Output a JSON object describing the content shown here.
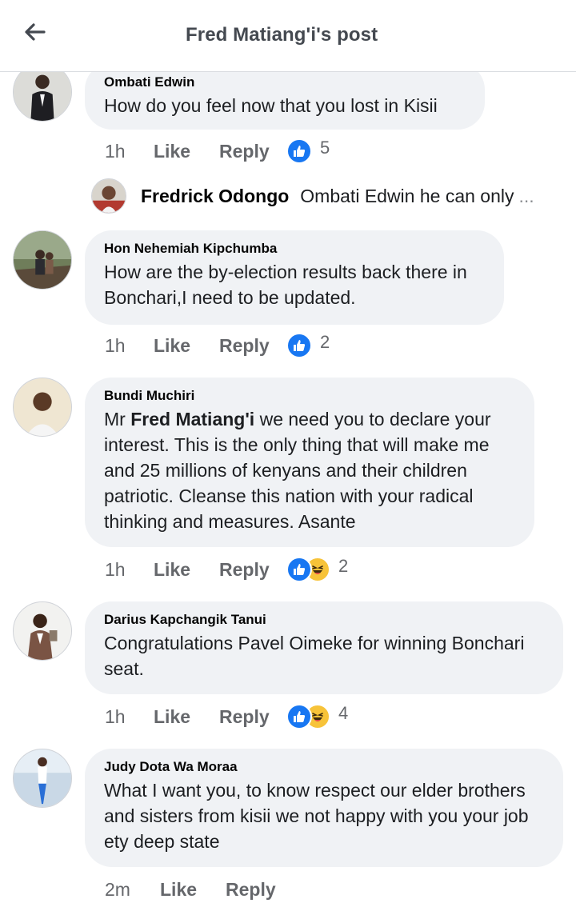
{
  "header": {
    "title": "Fred Matiang'i's post",
    "back_icon": "arrow-left-icon"
  },
  "comments": [
    {
      "author": "Ombati Edwin",
      "text": "How do you feel now that you lost in  Kisii",
      "time": "1h",
      "like_label": "Like",
      "reply_label": "Reply",
      "reactions": [
        "like"
      ],
      "reaction_count": "5"
    },
    {
      "author": "Hon Nehemiah Kipchumba",
      "text": "How are the by-election results back there in Bonchari,I need to be updated.",
      "time": "1h",
      "like_label": "Like",
      "reply_label": "Reply",
      "reactions": [
        "like"
      ],
      "reaction_count": "2"
    },
    {
      "author": "Bundi Muchiri",
      "text_prefix": "Mr ",
      "mention": "Fred Matiang'i",
      "text_suffix": " we need you to declare your interest. This is the only thing that will make me and 25 millions of kenyans and their children patriotic. Cleanse this nation with your radical thinking and measures. Asante",
      "time": "1h",
      "like_label": "Like",
      "reply_label": "Reply",
      "reactions": [
        "like",
        "haha"
      ],
      "reaction_count": "2"
    },
    {
      "author": "Darius Kapchangik Tanui",
      "text": "Congratulations Pavel Oimeke for winning Bonchari seat.",
      "time": "1h",
      "like_label": "Like",
      "reply_label": "Reply",
      "reactions": [
        "like",
        "haha"
      ],
      "reaction_count": "4"
    },
    {
      "author": "Judy Dota Wa Moraa",
      "text": "What I want you, to know respect our elder brothers and sisters from kisii we not happy with you your job ety deep state",
      "time": "2m",
      "like_label": "Like",
      "reply_label": "Reply"
    }
  ],
  "reply": {
    "author": "Fredrick Odongo",
    "text": "Ombati Edwin he can only",
    "ellipsis": "..."
  },
  "colors": {
    "bubble": "#f0f2f5",
    "action_text": "#65676b",
    "like_blue": "#1877f2",
    "haha_yellow": "#f7c339"
  }
}
